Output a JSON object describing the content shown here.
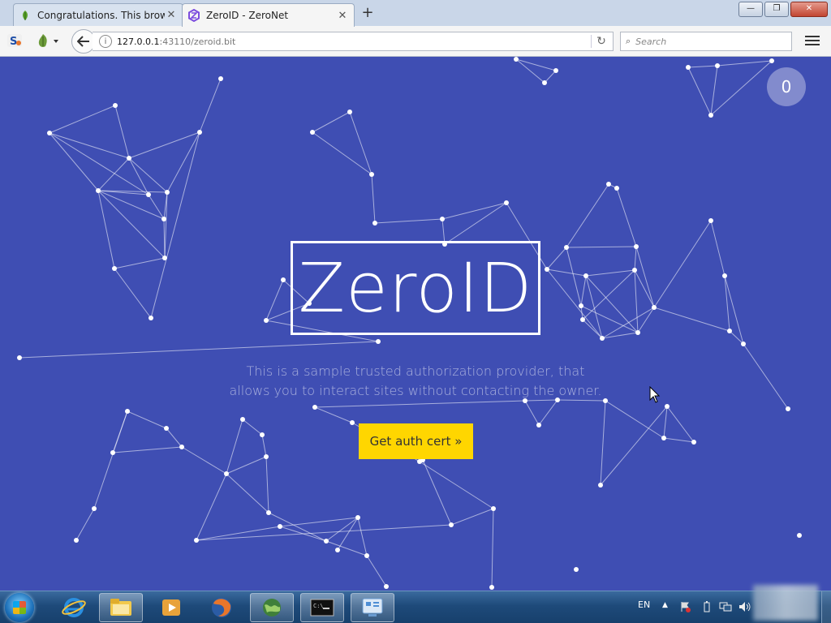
{
  "browser": {
    "tabs": [
      {
        "title": "Congratulations. This brow...",
        "active": false,
        "icon": "leaf-icon"
      },
      {
        "title": "ZeroID - ZeroNet",
        "active": true,
        "icon": "zeronet-hexagon-icon"
      }
    ],
    "new_tab_label": "+",
    "url": {
      "host": "127.0.0.1",
      "port_path": ":43110/zeroid.bit"
    },
    "search_placeholder": "Search",
    "window_buttons": {
      "minimize": "—",
      "maximize": "❐",
      "close": "✕"
    }
  },
  "page": {
    "logo": "ZeroID",
    "tagline_line1": "This is a sample trusted authorization provider, that",
    "tagline_line2": "allows you to interact sites without contacting the owner.",
    "cta_label": "Get auth cert »",
    "badge_count": "0",
    "colors": {
      "background": "#3f4eb3",
      "cta": "#ffd600",
      "line": "#ffffff"
    }
  },
  "taskbar": {
    "language": "EN",
    "pinned": [
      "windows-start-icon",
      "internet-explorer-icon",
      "file-explorer-icon",
      "media-player-icon",
      "firefox-icon",
      "zeronet-globe-icon",
      "command-prompt-icon",
      "control-panel-icon"
    ]
  }
}
